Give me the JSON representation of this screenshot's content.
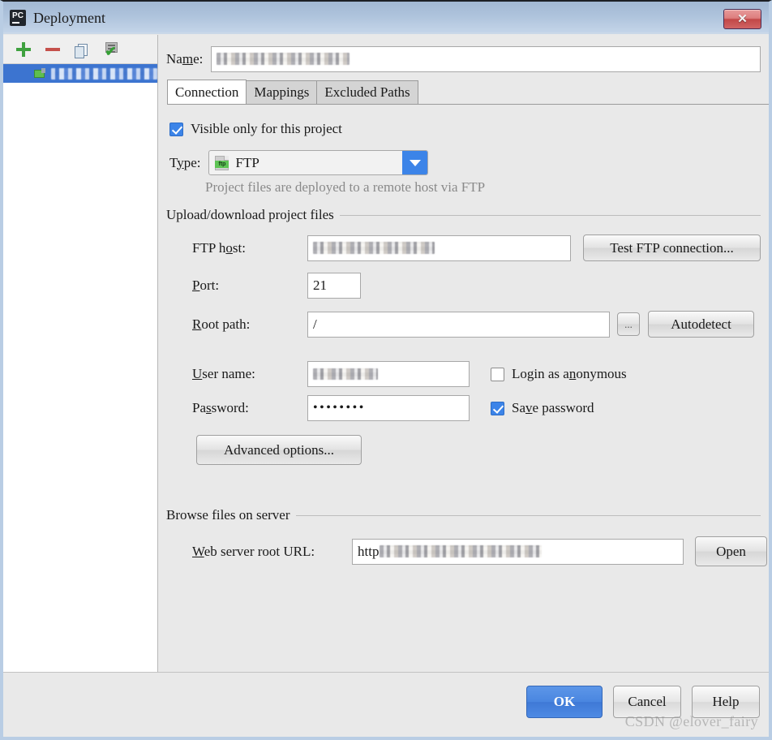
{
  "window": {
    "title": "Deployment",
    "app_icon": "pycharm-pc-icon",
    "close_label": "✕"
  },
  "sidebar": {
    "toolbar": [
      {
        "name": "add-server-button",
        "icon": "plus-icon"
      },
      {
        "name": "remove-server-button",
        "icon": "minus-icon"
      },
      {
        "name": "copy-server-button",
        "icon": "copy-icon"
      },
      {
        "name": "validate-server-button",
        "icon": "validate-check-icon"
      }
    ],
    "items": [
      {
        "label": "",
        "redacted": true,
        "selected": true,
        "icon": "ftp-server-icon"
      }
    ]
  },
  "form": {
    "name_label": "Na",
    "name_label_mnemonic": "m",
    "name_label_tail": "e:",
    "name_value": "",
    "name_redacted": true
  },
  "tabs": [
    {
      "label": "Connection",
      "active": true
    },
    {
      "label": "Mappings",
      "active": false
    },
    {
      "label": "Excluded Paths",
      "active": false
    }
  ],
  "connection": {
    "visible_only_checkbox": {
      "label": "Visible only for this project",
      "checked": true
    },
    "type": {
      "label_pre": "T",
      "label_mnemonic": "y",
      "label_post": "pe:",
      "value": "FTP",
      "icon": "ftp-file-icon",
      "dropdown_icon": "chevron-down-icon"
    },
    "type_hint": "Project files are deployed to a remote host via FTP",
    "upload_group": {
      "title": "Upload/download project files",
      "ftp_host": {
        "label_pre": "FTP h",
        "label_mnemonic": "o",
        "label_post": "st:",
        "value": "",
        "redacted": true
      },
      "test_button": "Test FTP connection...",
      "port": {
        "label_pre": "",
        "label_mnemonic": "P",
        "label_post": "ort:",
        "value": "21"
      },
      "root_path": {
        "label_pre": "",
        "label_mnemonic": "R",
        "label_post": "oot path:",
        "value": "/",
        "browse_button": "...",
        "autodetect_button": "Autodetect"
      },
      "user_name": {
        "label_pre": "",
        "label_mnemonic": "U",
        "label_post": "ser name:",
        "value": "",
        "redacted": true
      },
      "login_anonymous": {
        "label_pre": "Login as a",
        "label_mnemonic": "n",
        "label_post": "onymous",
        "checked": false
      },
      "password": {
        "label_pre": "Pa",
        "label_mnemonic": "s",
        "label_post": "sword:",
        "value": "••••••••"
      },
      "save_password": {
        "label_pre": "Sa",
        "label_mnemonic": "v",
        "label_post": "e password",
        "checked": true
      },
      "advanced_button": "Advanced options..."
    },
    "browse_group": {
      "title": "Browse files on server",
      "web_url": {
        "label_pre": "",
        "label_mnemonic": "W",
        "label_post": "eb server root URL:",
        "value": "http",
        "redacted": true
      },
      "open_button": "Open"
    }
  },
  "footer": {
    "ok": "OK",
    "cancel": "Cancel",
    "help": "Help",
    "watermark": "CSDN @elover_fairy"
  },
  "colors": {
    "accent_blue": "#3c84e8",
    "selection_blue": "#3c74d0",
    "close_red": "#c24848",
    "panel_gray": "#e9e9e9"
  }
}
